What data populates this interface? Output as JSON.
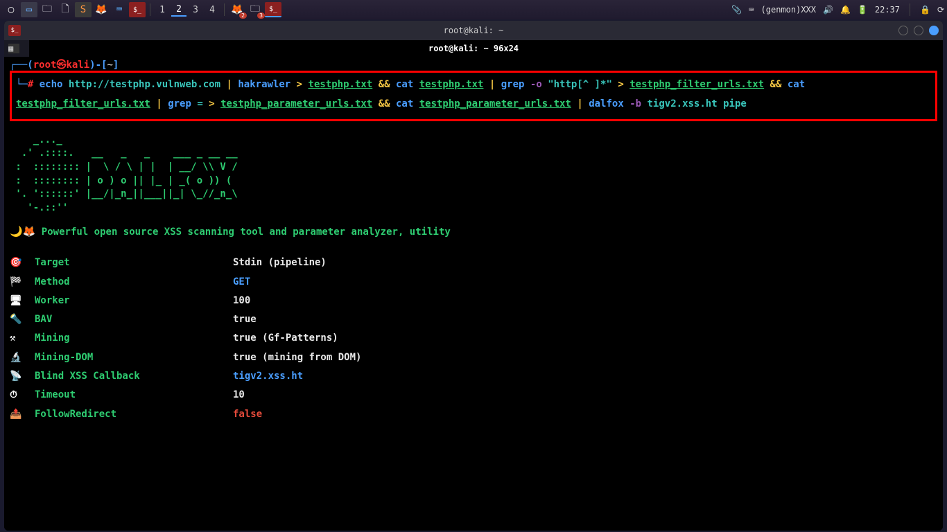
{
  "taskbar": {
    "workspaces": [
      "1",
      "2",
      "3",
      "4"
    ],
    "active_workspace": 1,
    "genmon": "(genmon)XXX",
    "time": "22:37",
    "badges": {
      "app1": "2",
      "app2": "3"
    }
  },
  "window": {
    "title": "root@kali: ~",
    "tab_title": "root@kali: ~ 96x24"
  },
  "prompt": {
    "open": "┌──(",
    "user": "root",
    "at": "㉿",
    "host": "kali",
    "close": ")-[",
    "path": "~",
    "close2": "]",
    "line2_prefix": "└─",
    "hash": "#"
  },
  "command": {
    "echo": "echo",
    "url": "http://testphp.vulnweb.com",
    "pipe": "|",
    "hakrawler": "hakrawler",
    "gt": ">",
    "file1": "testphp.txt",
    "amp": "&&",
    "cat": "cat",
    "grep": "grep",
    "flag_o": "-o",
    "regex": "\"http[^ ]*\"",
    "file2": "testphp_filter_urls.txt",
    "eq": "=",
    "file3": "testphp_parameter_urls.txt",
    "dalfox": "dalfox",
    "flag_b": "-b",
    "blind": "tigv2.xss.ht",
    "pipe_mode": "pipe"
  },
  "ascii": "    _..._\n  .' .::::.   __   _   _    ___ _ __ __\n :  :::::::: |  \\ / \\ | |  | __/ \\\\ V /\n :  :::::::: | o ) o || |_ | _( o )) (\n '. '::::::' |__/|_n_||___||_| \\_//_n_\\\n   '-.::''",
  "tagline": {
    "emoji": "🌙🦊",
    "text": "Powerful open source XSS scanning tool and parameter analyzer, utility"
  },
  "info": [
    {
      "icon": "🎯",
      "key": "Target",
      "val": "Stdin (pipeline)",
      "cls": "val-white"
    },
    {
      "icon": "🏁",
      "key": "Method",
      "val": "GET",
      "cls": "val-blue"
    },
    {
      "icon": "🖥",
      "key": "Worker",
      "val": "100",
      "cls": "val-white"
    },
    {
      "icon": "🔦",
      "key": "BAV",
      "val": "true",
      "cls": "val-white"
    },
    {
      "icon": "⚒",
      "key": "Mining",
      "val": "true (Gf-Patterns)",
      "cls": "val-white"
    },
    {
      "icon": "🔬",
      "key": "Mining-DOM",
      "val": "true (mining from DOM)",
      "cls": "val-white"
    },
    {
      "icon": "📡",
      "key": "Blind XSS Callback",
      "val": "tigv2.xss.ht",
      "cls": "val-blue"
    },
    {
      "icon": "⏱",
      "key": "Timeout",
      "val": "10",
      "cls": "val-white"
    },
    {
      "icon": "📤",
      "key": "FollowRedirect",
      "val": "false",
      "cls": "val-red"
    }
  ]
}
